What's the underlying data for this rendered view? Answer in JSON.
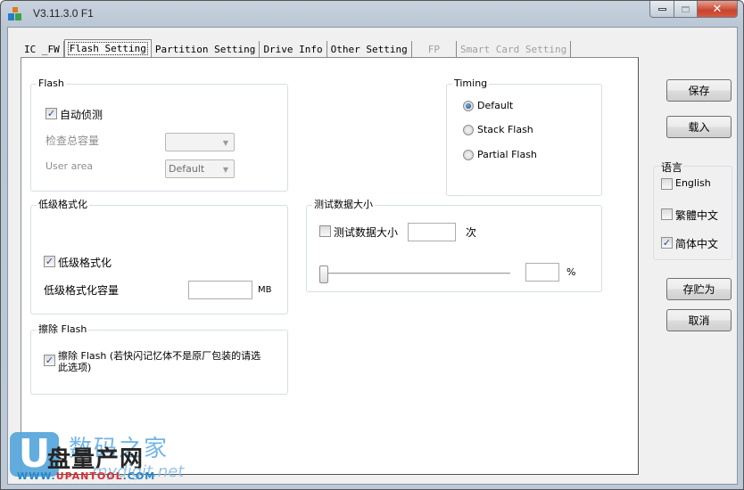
{
  "window": {
    "title": "V3.11.3.0 F1",
    "controls": {
      "minimize": "minimize",
      "maximize": "maximize",
      "close": "✕"
    }
  },
  "tabs": [
    {
      "label": "IC _FW",
      "state": "normal"
    },
    {
      "label": "Flash Setting",
      "state": "active"
    },
    {
      "label": "Partition Setting",
      "state": "normal"
    },
    {
      "label": "Drive Info",
      "state": "normal"
    },
    {
      "label": "Other Setting",
      "state": "normal"
    },
    {
      "label": "FP",
      "state": "disabled"
    },
    {
      "label": "Smart Card Setting",
      "state": "disabled"
    }
  ],
  "flash_group": {
    "title": "Flash",
    "auto_detect": {
      "label": "自动侦测",
      "checked": true
    },
    "check_capacity": {
      "label": "检查总容量",
      "value": "",
      "enabled": false
    },
    "user_area": {
      "label": "User area",
      "value": "Default",
      "enabled": false
    }
  },
  "timing_group": {
    "title": "Timing",
    "options": [
      {
        "label": "Default",
        "selected": true
      },
      {
        "label": "Stack Flash",
        "selected": false
      },
      {
        "label": "Partial Flash",
        "selected": false
      }
    ]
  },
  "low_format_group": {
    "title": "低级格式化",
    "checkbox": {
      "label": "低级格式化",
      "checked": true
    },
    "capacity_label": "低级格式化容量",
    "capacity_value": "",
    "unit": "MB"
  },
  "test_data_group": {
    "title": "测试数据大小",
    "checkbox": {
      "label": "测试数据大小",
      "checked": false
    },
    "count_value": "",
    "count_unit": "次",
    "slider_percent": 0,
    "percent_value": "",
    "percent_unit": "%"
  },
  "erase_group": {
    "title": "擦除 Flash",
    "checkbox": {
      "label_line1": "擦除 Flash (若快闪记忆体不是原厂包装的请选",
      "label_line2": "此选项)",
      "checked": true
    }
  },
  "side_buttons": {
    "save": "保存",
    "load": "载入",
    "save_as": "存贮为",
    "cancel": "取消"
  },
  "language": {
    "title": "语言",
    "options": [
      {
        "label": "English",
        "checked": false
      },
      {
        "label": "繁體中文",
        "checked": false
      },
      {
        "label": "简体中文",
        "checked": true
      }
    ]
  },
  "watermark": {
    "logo_letter": "U",
    "cn_main": "盘量产网",
    "cn_sub": "数码之家",
    "url_main_a": "WWW.",
    "url_main_b": "UPANTOOL",
    "url_main_c": ".COM",
    "url_sub": "mydigit.net"
  }
}
